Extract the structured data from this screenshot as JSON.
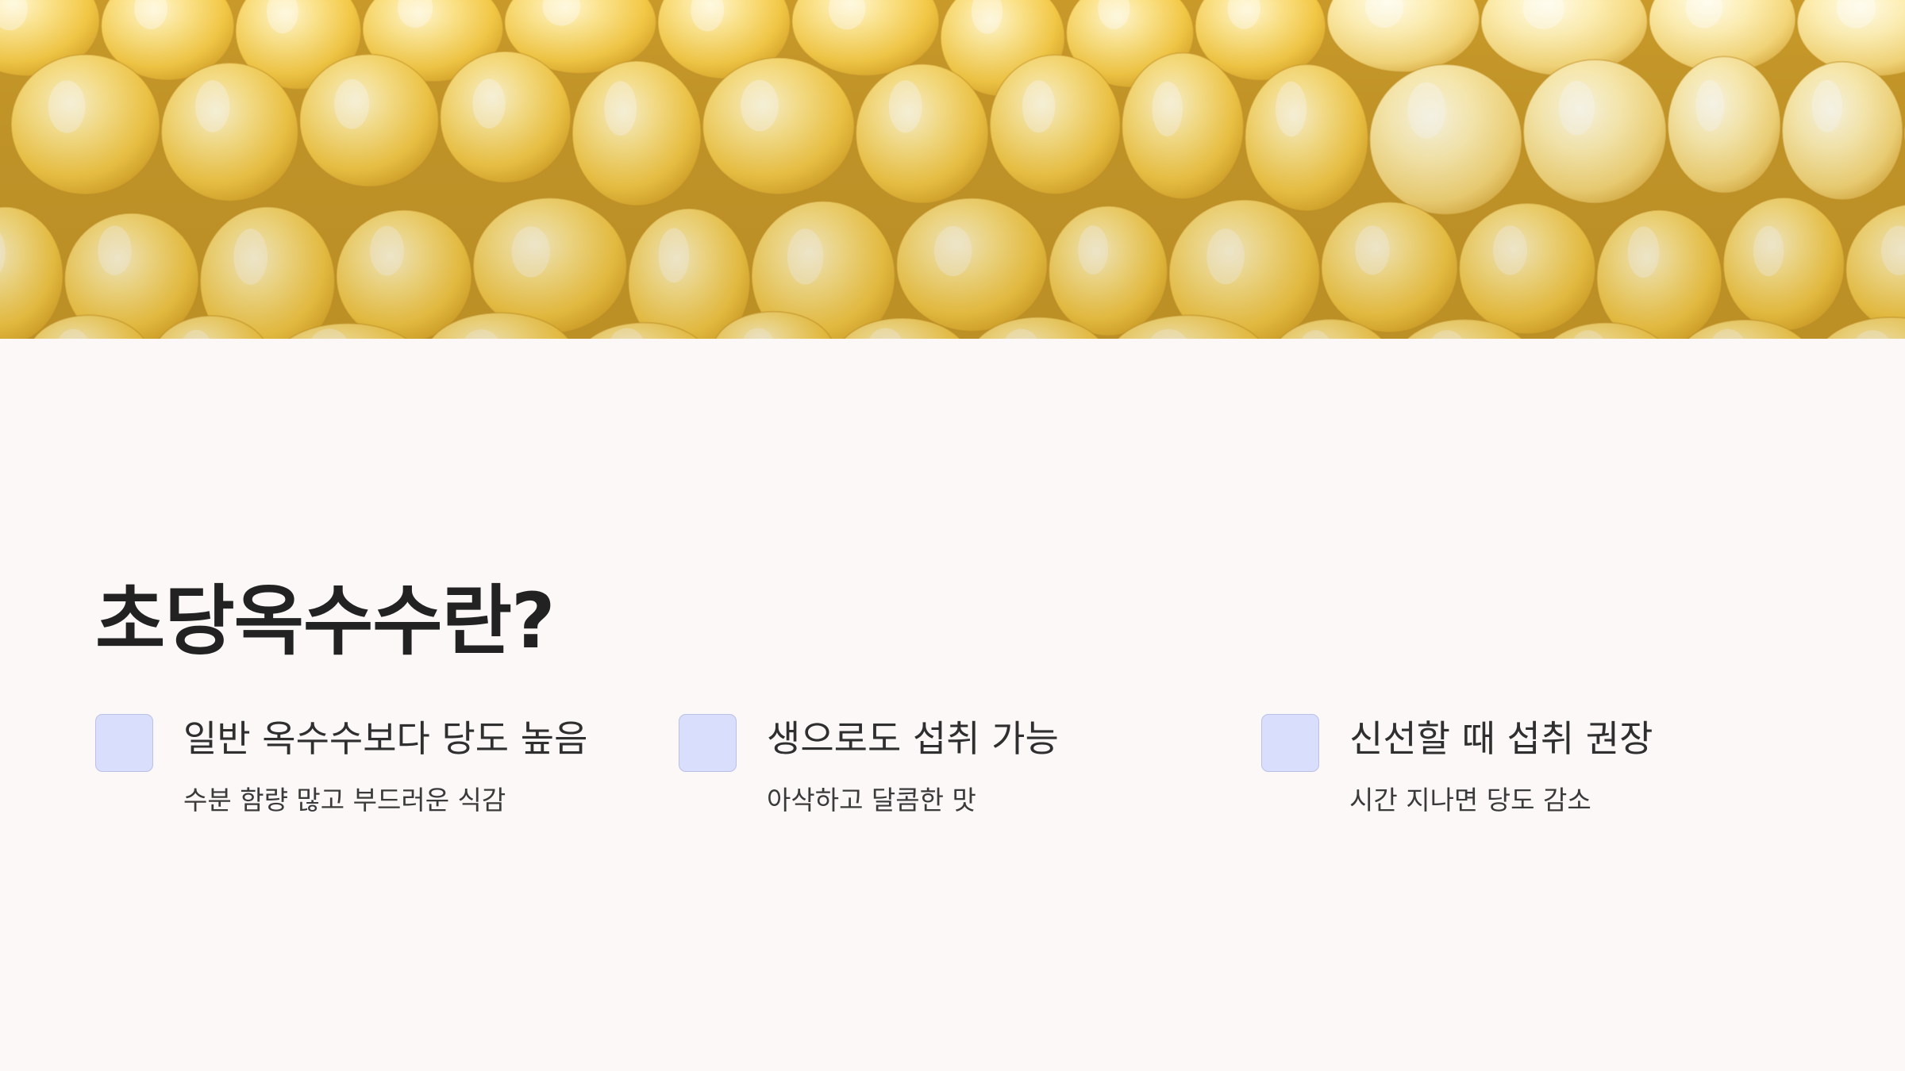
{
  "title": "초당옥수수란?",
  "hero_image": {
    "subject": "corn-kernels-photo",
    "base_color": "#f0c24a",
    "kernel_colors": [
      "#f6cf52",
      "#f9d86a",
      "#fbe493",
      "#fdf1c4"
    ]
  },
  "features": [
    {
      "icon": "feature-square-icon",
      "title": "일반 옥수수보다 당도 높음",
      "description": "수분 함량 많고 부드러운 식감"
    },
    {
      "icon": "feature-square-icon",
      "title": "생으로도 섭취 가능",
      "description": "아삭하고 달콤한 맛"
    },
    {
      "icon": "feature-square-icon",
      "title": "신선할 때 섭취 권장",
      "description": "시간 지나면 당도 감소"
    }
  ],
  "colors": {
    "background": "#fbf8f7",
    "icon_fill": "#d8defb",
    "icon_border": "#b9c1e6",
    "title_text": "#222222"
  }
}
